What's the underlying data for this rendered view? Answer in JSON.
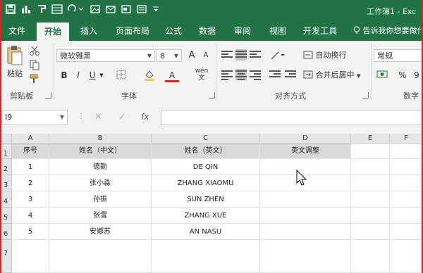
{
  "window": {
    "title": "工作簿1 - Exc"
  },
  "qat": {
    "save_icon": "save-icon",
    "chart_icon": "chart-icon",
    "paint_icon": "format-painter-icon"
  },
  "tabs": [
    "文件",
    "开始",
    "插入",
    "页面布局",
    "公式",
    "数据",
    "审阅",
    "视图",
    "开发工具"
  ],
  "active_tab": "开始",
  "tell_me": "告诉我你想要做什",
  "ribbon": {
    "clipboard": {
      "label": "剪贴板",
      "paste": "粘贴"
    },
    "font": {
      "label": "字体",
      "name": "微软雅黑",
      "size": "8",
      "bold": "B",
      "italic": "I",
      "underline": "U",
      "color_letter": "A",
      "wen": "wén",
      "wen2": "文",
      "grow": "A",
      "shrink": "A"
    },
    "alignment": {
      "label": "对齐方式",
      "wrap": "自动换行",
      "merge": "合并后居中"
    },
    "number": {
      "label": "数字",
      "format": "常规",
      "percent": "%",
      "comma": "9"
    }
  },
  "formula_bar": {
    "name_box": "I9",
    "cancel": "✕",
    "enter": "✓",
    "fx": "fx",
    "value": ""
  },
  "sheet": {
    "columns": [
      "A",
      "B",
      "C",
      "D",
      "E",
      "F"
    ],
    "rows": [
      "1",
      "2",
      "3",
      "4",
      "5",
      "6",
      "7"
    ],
    "header": [
      "序号",
      "姓名（中文）",
      "姓名（英文）",
      "英文调整"
    ],
    "data": [
      [
        "1",
        "德勤",
        "DE QIN",
        ""
      ],
      [
        "2",
        "张小淼",
        "ZHANG XIAOMU",
        ""
      ],
      [
        "3",
        "孙振",
        "SUN ZHEN",
        ""
      ],
      [
        "4",
        "张雪",
        "ZHANG XUE",
        ""
      ],
      [
        "5",
        "安娜苏",
        "AN NASU",
        ""
      ]
    ]
  },
  "colors": {
    "excel_green": "#217346",
    "ribbon_bg": "#f3f3f3",
    "font_red": "#e02020",
    "highlight_yellow": "#f6d24a"
  }
}
